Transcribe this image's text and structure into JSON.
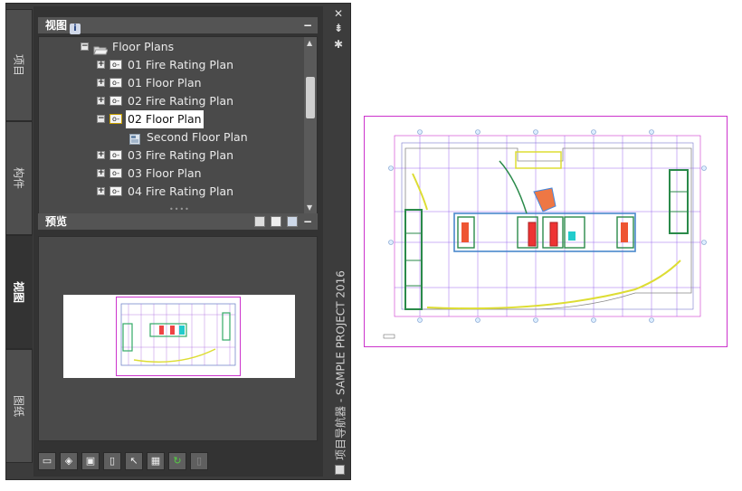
{
  "tabs": [
    {
      "label": "项目"
    },
    {
      "label": "构件"
    },
    {
      "label": "视图"
    },
    {
      "label": "图纸"
    }
  ],
  "views_panel": {
    "title": "视图",
    "info_icon": "i",
    "minimize": "−",
    "tree": [
      {
        "label": "Floor Plans",
        "expander": "−",
        "icon": "folder-open-icon"
      },
      {
        "label": "01 Fire Rating Plan",
        "expander": "+",
        "icon": "floor-plan-view-icon"
      },
      {
        "label": "01 Floor Plan",
        "expander": "+",
        "icon": "floor-plan-view-icon"
      },
      {
        "label": "02 Fire Rating Plan",
        "expander": "+",
        "icon": "floor-plan-view-icon"
      },
      {
        "label": "02 Floor Plan",
        "expander": "−",
        "icon": "floor-plan-view-locked-icon",
        "selected": true
      },
      {
        "label": "Second Floor Plan",
        "expander": "",
        "icon": "sheet-icon"
      },
      {
        "label": "03 Fire Rating Plan",
        "expander": "+",
        "icon": "floor-plan-view-icon"
      },
      {
        "label": "03 Floor Plan",
        "expander": "+",
        "icon": "floor-plan-view-icon"
      },
      {
        "label": "04 Fire Rating Plan",
        "expander": "+",
        "icon": "floor-plan-view-icon"
      }
    ]
  },
  "preview_panel": {
    "title": "预览",
    "minimize": "−",
    "header_icons": [
      "preview-mode-icon",
      "fit-view-icon",
      "render-icon"
    ]
  },
  "toolbar_icons": [
    "new-view-icon",
    "new-camera-view-icon",
    "new-section-icon",
    "delete-view-icon",
    "view-properties-icon",
    "sheet-setup-icon",
    "refresh-icon",
    "placeholder-icon"
  ],
  "side_title": "项目导航器 - SAMPLE PROJECT 2016",
  "side_icons": {
    "close": "✕",
    "pin": "⇟",
    "settings": "✱"
  },
  "colors": {
    "drawing_border": "#cc33cc",
    "palette_bg": "#3c3c3c",
    "selection": "#ffffff"
  }
}
